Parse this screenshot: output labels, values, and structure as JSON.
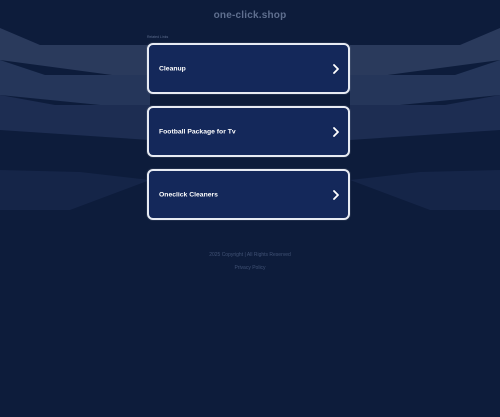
{
  "page": {
    "domain": "one-click.shop",
    "related_label": "Related Links"
  },
  "links": [
    {
      "label": "Cleanup"
    },
    {
      "label": "Football Package for Tv"
    },
    {
      "label": "Oneclick Cleaners"
    }
  ],
  "footer": {
    "line1": "2025 Copyright | All Rights Reserved",
    "line2": "Privacy Policy"
  },
  "colors": {
    "background": "#0d1c3b",
    "card_fill": "#14285a",
    "card_border": "#e7ebf3"
  },
  "icons": {
    "card_arrow": "chevron-right-icon"
  }
}
